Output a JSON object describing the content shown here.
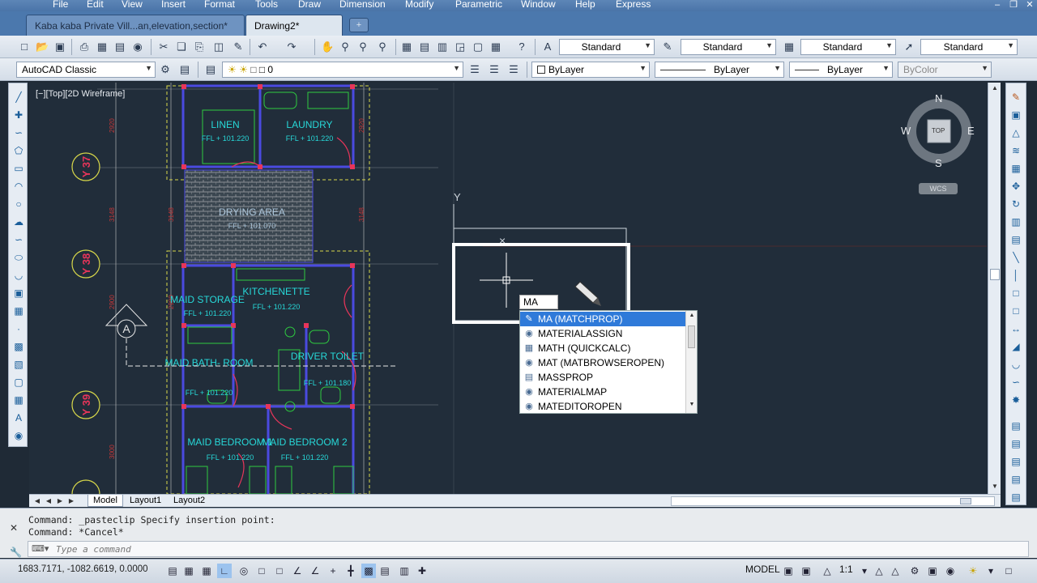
{
  "menu": [
    "File",
    "Edit",
    "View",
    "Insert",
    "Format",
    "Tools",
    "Draw",
    "Dimension",
    "Modify",
    "Parametric",
    "Window",
    "Help",
    "Express"
  ],
  "tabs": [
    {
      "label": "Kaba kaba Private Vill...an,elevation,section*"
    },
    {
      "label": "Drawing2*"
    }
  ],
  "styles": {
    "text_style": "Standard",
    "dim_style": "Standard",
    "table_style": "Standard",
    "mleader_style": "Standard"
  },
  "workspace": "AutoCAD Classic",
  "layer": "0",
  "properties": {
    "color": "ByLayer",
    "linetype": "ByLayer",
    "lineweight": "ByLayer",
    "plotstyle": "ByColor"
  },
  "viewport_label": "[−][Top][2D Wireframe]",
  "viewcube": {
    "north": "N",
    "south": "S",
    "east": "E",
    "west": "W",
    "face": "TOP",
    "ucs": "WCS"
  },
  "drawing": {
    "rooms": [
      {
        "name": "LINEN",
        "level": "FFL + 101.220"
      },
      {
        "name": "LAUNDRY",
        "level": "FFL + 101.220"
      },
      {
        "name": "DRYING AREA",
        "level": "FFL + 101.070"
      },
      {
        "name": "MAID STORAGE",
        "level": "FFL + 101.220"
      },
      {
        "name": "KITCHENETTE",
        "level": "FFL + 101.220"
      },
      {
        "name": "MAID BATH- ROOM",
        "level": "FFL + 101.220"
      },
      {
        "name": "DRIVER TOILET",
        "level": "FFL + 101.180"
      },
      {
        "name": "MAID BEDROOM 1",
        "level": "FFL + 101.220"
      },
      {
        "name": "MAID BEDROOM 2",
        "level": "FFL + 101.220"
      }
    ],
    "grid_labels": [
      "Y 37",
      "Y 38",
      "Y 39"
    ],
    "section_marker": "A",
    "ucs_axis": "Y"
  },
  "autocomplete": {
    "typed": "MA",
    "items": [
      {
        "label": "MA (MATCHPROP)",
        "icon": "matchprop-icon"
      },
      {
        "label": "MATERIALASSIGN",
        "icon": "material-assign-icon"
      },
      {
        "label": "MATH (QUICKCALC)",
        "icon": "calculator-icon"
      },
      {
        "label": "MAT (MATBROWSEROPEN)",
        "icon": "material-browser-icon"
      },
      {
        "label": "MASSPROP",
        "icon": "massprop-icon"
      },
      {
        "label": "MATERIALMAP",
        "icon": "material-map-icon"
      },
      {
        "label": "MATEDITOROPEN",
        "icon": "material-editor-icon"
      }
    ],
    "selected_index": 0
  },
  "layout_tabs": [
    "Model",
    "Layout1",
    "Layout2"
  ],
  "command_history": [
    "Command: _pasteclip Specify insertion point:",
    "Command: *Cancel*"
  ],
  "command_placeholder": "Type a command",
  "status": {
    "coordinates": "1683.7171, -1082.6619, 0.0000",
    "space": "MODEL",
    "scale": "1:1"
  }
}
